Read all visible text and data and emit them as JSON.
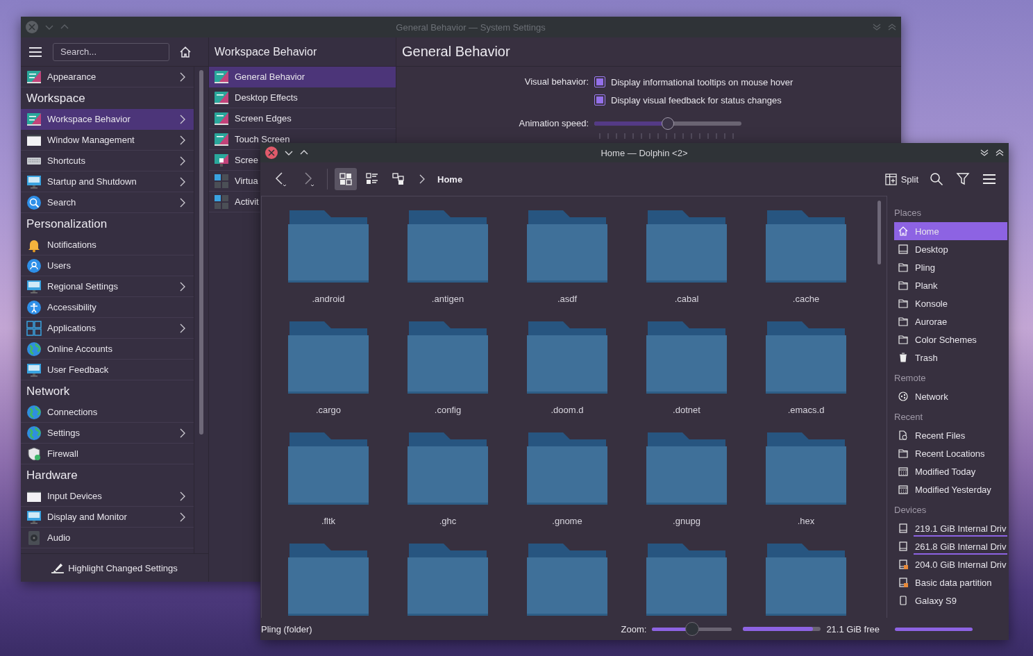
{
  "settings_window": {
    "title": "General Behavior — System Settings",
    "search": {
      "placeholder": "Search..."
    },
    "sidebar": [
      {
        "kind": "item",
        "label": "Appearance",
        "has_children": true,
        "selected": false
      },
      {
        "kind": "header",
        "label": "Workspace"
      },
      {
        "kind": "item",
        "label": "Workspace Behavior",
        "has_children": true,
        "selected": true
      },
      {
        "kind": "item",
        "label": "Window Management",
        "has_children": true,
        "selected": false
      },
      {
        "kind": "item",
        "label": "Shortcuts",
        "has_children": true,
        "selected": false
      },
      {
        "kind": "item",
        "label": "Startup and Shutdown",
        "has_children": true,
        "selected": false
      },
      {
        "kind": "item",
        "label": "Search",
        "has_children": true,
        "selected": false
      },
      {
        "kind": "header",
        "label": "Personalization"
      },
      {
        "kind": "item",
        "label": "Notifications",
        "has_children": false,
        "selected": false
      },
      {
        "kind": "item",
        "label": "Users",
        "has_children": false,
        "selected": false
      },
      {
        "kind": "item",
        "label": "Regional Settings",
        "has_children": true,
        "selected": false
      },
      {
        "kind": "item",
        "label": "Accessibility",
        "has_children": false,
        "selected": false
      },
      {
        "kind": "item",
        "label": "Applications",
        "has_children": true,
        "selected": false
      },
      {
        "kind": "item",
        "label": "Online Accounts",
        "has_children": false,
        "selected": false
      },
      {
        "kind": "item",
        "label": "User Feedback",
        "has_children": false,
        "selected": false
      },
      {
        "kind": "header",
        "label": "Network"
      },
      {
        "kind": "item",
        "label": "Connections",
        "has_children": false,
        "selected": false
      },
      {
        "kind": "item",
        "label": "Settings",
        "has_children": true,
        "selected": false
      },
      {
        "kind": "item",
        "label": "Firewall",
        "has_children": false,
        "selected": false
      },
      {
        "kind": "header",
        "label": "Hardware"
      },
      {
        "kind": "item",
        "label": "Input Devices",
        "has_children": true,
        "selected": false
      },
      {
        "kind": "item",
        "label": "Display and Monitor",
        "has_children": true,
        "selected": false
      },
      {
        "kind": "item",
        "label": "Audio",
        "has_children": false,
        "selected": false
      }
    ],
    "subpage": {
      "title": "Workspace Behavior",
      "items": [
        {
          "label": "General Behavior",
          "selected": true
        },
        {
          "label": "Desktop Effects",
          "selected": false
        },
        {
          "label": "Screen Edges",
          "selected": false
        },
        {
          "label": "Touch Screen",
          "selected": false
        },
        {
          "label": "Scree",
          "selected": false
        },
        {
          "label": "Virtua",
          "selected": false
        },
        {
          "label": "Activit",
          "selected": false
        }
      ]
    },
    "page": {
      "title": "General Behavior",
      "visual_label": "Visual behavior:",
      "checkboxes": [
        {
          "label": "Display informational tooltips on mouse hover",
          "checked": true
        },
        {
          "label": "Display visual feedback for status changes",
          "checked": true
        }
      ],
      "animation": {
        "label": "Animation speed:",
        "level": 0.5
      }
    },
    "footer": {
      "label": "Highlight Changed Settings"
    }
  },
  "dolphin": {
    "title": "Home — Dolphin <2>",
    "view_modes": [
      {
        "selected": true
      },
      {
        "selected": false
      },
      {
        "selected": false
      }
    ],
    "breadcrumb": "Home",
    "split_label": "Split",
    "folders": [
      {
        "kind": "folder",
        "name": ".android"
      },
      {
        "kind": "folder",
        "name": ".antigen"
      },
      {
        "kind": "folder",
        "name": ".asdf"
      },
      {
        "kind": "folder",
        "name": ".cabal"
      },
      {
        "kind": "folder",
        "name": ".cache"
      },
      {
        "kind": "folder",
        "name": ".cargo"
      },
      {
        "kind": "folder",
        "name": ".config"
      },
      {
        "kind": "folder",
        "name": ".doom.d"
      },
      {
        "kind": "folder",
        "name": ".dotnet"
      },
      {
        "kind": "folder",
        "name": ".emacs.d"
      },
      {
        "kind": "folder",
        "name": ".fltk"
      },
      {
        "kind": "folder",
        "name": ".ghc"
      },
      {
        "kind": "folder",
        "name": ".gnome"
      },
      {
        "kind": "folder",
        "name": ".gnupg"
      },
      {
        "kind": "folder",
        "name": ".hex"
      },
      {
        "kind": "folder"
      },
      {
        "kind": "folder"
      },
      {
        "kind": "folder"
      },
      {
        "kind": "folder"
      },
      {
        "kind": "folder"
      }
    ],
    "places": [
      {
        "heading": "Places",
        "items": [
          {
            "label": "Home",
            "selected": true
          },
          {
            "label": "Desktop",
            "selected": false
          },
          {
            "label": "Pling",
            "selected": false
          },
          {
            "label": "Plank",
            "selected": false
          },
          {
            "label": "Konsole",
            "selected": false
          },
          {
            "label": "Aurorae",
            "selected": false
          },
          {
            "label": "Color Schemes",
            "selected": false
          },
          {
            "label": "Trash",
            "selected": false
          }
        ]
      },
      {
        "heading": "Remote",
        "items": [
          {
            "label": "Network",
            "selected": false
          }
        ]
      },
      {
        "heading": "Recent",
        "items": [
          {
            "label": "Recent Files",
            "selected": false
          },
          {
            "label": "Recent Locations",
            "selected": false
          },
          {
            "label": "Modified Today",
            "selected": false
          },
          {
            "label": "Modified Yesterday",
            "selected": false
          }
        ]
      },
      {
        "heading": "Devices",
        "items": [
          {
            "label": "219.1 GiB Internal Driv",
            "selected": false,
            "level": 1
          },
          {
            "label": "261.8 GiB Internal Driv",
            "selected": false,
            "level": 1
          },
          {
            "label": "204.0 GiB Internal Driv",
            "selected": false
          },
          {
            "label": "Basic data partition",
            "selected": false
          },
          {
            "label": "Galaxy S9",
            "selected": false
          }
        ]
      }
    ],
    "status": {
      "text": "Pling (folder)",
      "zoom": {
        "label": "Zoom:",
        "level": 0.5
      },
      "free_space": {
        "level": 0.9,
        "text": "21.1 GiB free"
      }
    }
  }
}
